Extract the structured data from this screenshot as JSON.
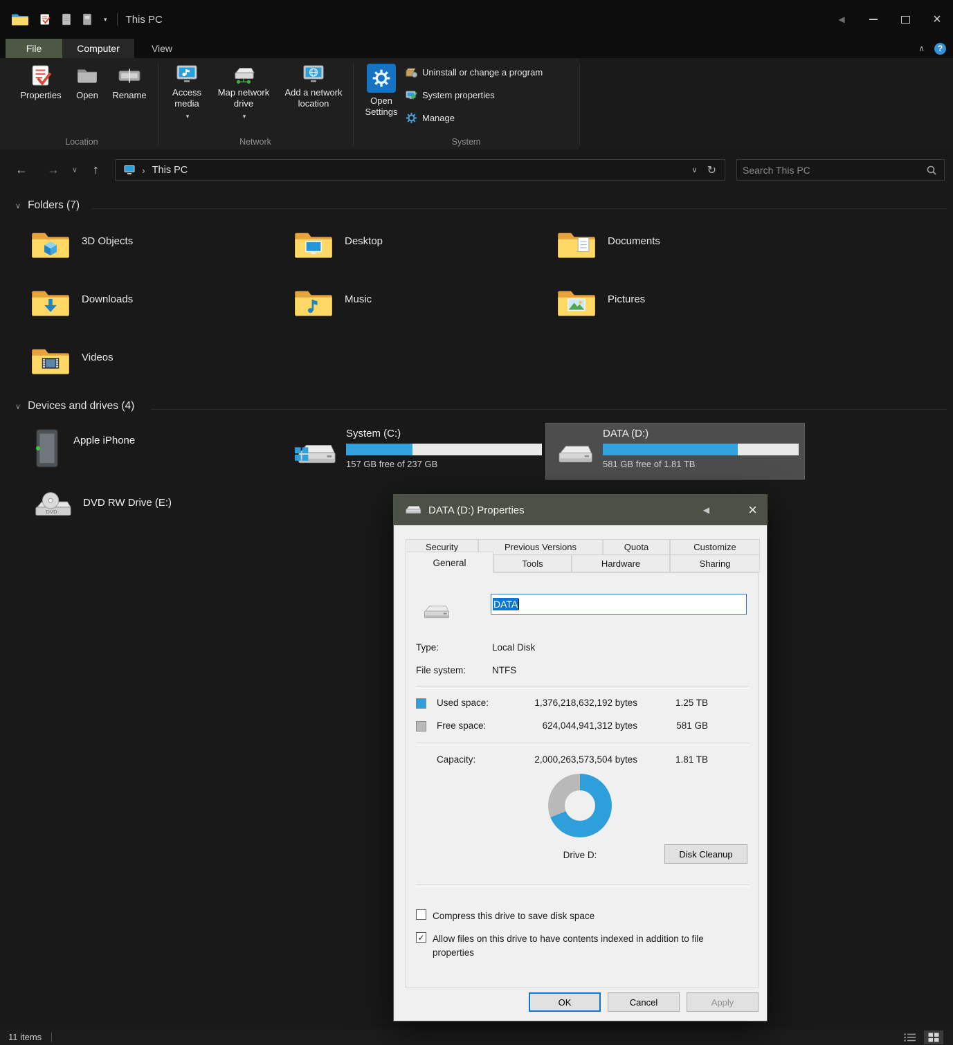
{
  "titlebar": {
    "title": "This PC"
  },
  "tabs": {
    "file": "File",
    "computer": "Computer",
    "view": "View"
  },
  "ribbon": {
    "location": {
      "label": "Location",
      "properties": "Properties",
      "open": "Open",
      "rename": "Rename"
    },
    "network": {
      "label": "Network",
      "access_media": "Access media",
      "map_drive": "Map network drive",
      "add_location": "Add a network location"
    },
    "system": {
      "label": "System",
      "open_settings": "Open Settings",
      "uninstall": "Uninstall or change a program",
      "sys_props": "System properties",
      "manage": "Manage"
    }
  },
  "navbar": {
    "breadcrumb": "This PC",
    "search_placeholder": "Search This PC"
  },
  "content": {
    "folders_header": "Folders (7)",
    "folders": [
      "3D Objects",
      "Desktop",
      "Documents",
      "Downloads",
      "Music",
      "Pictures",
      "Videos"
    ],
    "devices_header": "Devices and drives (4)",
    "devices": {
      "iphone": {
        "name": "Apple iPhone"
      },
      "c": {
        "name": "System (C:)",
        "free": "157 GB free of 237 GB",
        "used_width": "34%"
      },
      "d": {
        "name": "DATA (D:)",
        "free": "581 GB free of 1.81 TB",
        "used_width": "69%"
      },
      "dvd": {
        "name": "DVD RW Drive (E:)"
      }
    }
  },
  "statusbar": {
    "items": "11 items"
  },
  "dialog": {
    "title": "DATA (D:) Properties",
    "tabs_row1": [
      "Security",
      "Previous Versions",
      "Quota",
      "Customize"
    ],
    "tabs_row2": [
      "General",
      "Tools",
      "Hardware",
      "Sharing"
    ],
    "volume_label": "DATA",
    "type_label": "Type:",
    "type_value": "Local Disk",
    "fs_label": "File system:",
    "fs_value": "NTFS",
    "used_label": "Used space:",
    "used_bytes": "1,376,218,632,192 bytes",
    "used_size": "1.25 TB",
    "free_label": "Free space:",
    "free_bytes": "624,044,941,312 bytes",
    "free_size": "581 GB",
    "capacity_label": "Capacity:",
    "capacity_bytes": "2,000,263,573,504 bytes",
    "capacity_size": "1.81 TB",
    "drive_caption": "Drive D:",
    "disk_cleanup_label": "Disk Cleanup",
    "compress_label": "Compress this drive to save disk space",
    "index_label": "Allow files on this drive to have contents indexed in addition to file properties",
    "ok_label": "OK",
    "cancel_label": "Cancel",
    "apply_label": "Apply",
    "used_color": "#2f9fdc",
    "free_color": "#b9b9b9"
  },
  "icons": {
    "dvd_label": "DVD"
  },
  "glyphs": {
    "back": "←",
    "forward": "→",
    "up": "↑",
    "chevron_down": "∨",
    "chevron_up": "∧",
    "caret": "▾",
    "crumb_sep": "›",
    "refresh": "↻",
    "close": "×",
    "help": "?",
    "dialog_back": "◀",
    "check": "✓"
  }
}
